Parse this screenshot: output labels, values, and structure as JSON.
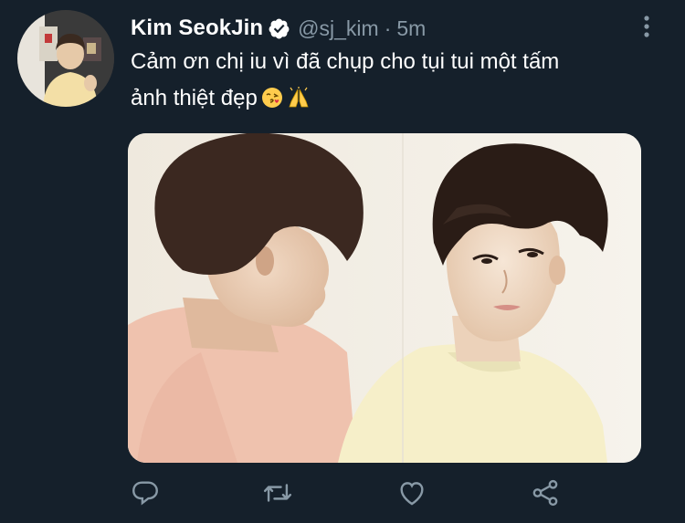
{
  "tweet": {
    "display_name": "Kim SeokJin",
    "handle": "@sj_kim",
    "separator": "·",
    "time": "5m",
    "text_line1": "Cảm ơn chị iu vì đã chụp cho tụi tui một tấm",
    "text_line2": "ảnh thiệt đẹp",
    "emoji": [
      "face-blowing-kiss",
      "folded-hands"
    ],
    "verified": true
  },
  "actions": [
    "reply-icon",
    "retweet-icon",
    "like-icon",
    "share-icon"
  ],
  "colors": {
    "background": "#15202b",
    "secondary_text": "#8899a6",
    "primary_text": "#ffffff"
  }
}
